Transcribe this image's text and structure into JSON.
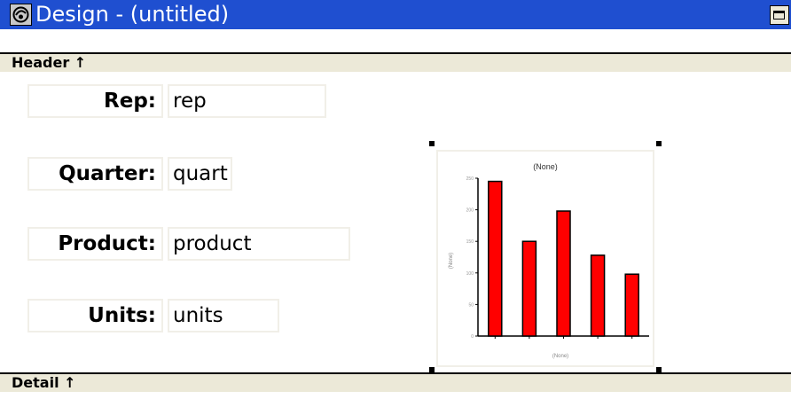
{
  "window": {
    "title": "Design - (untitled)"
  },
  "sections": {
    "header_label": "Header ↑",
    "detail_label": "Detail ↑"
  },
  "fields": [
    {
      "label": "Rep:",
      "value": "rep"
    },
    {
      "label": "Quarter:",
      "value": "quart"
    },
    {
      "label": "Product:",
      "value": "product"
    },
    {
      "label": "Units:",
      "value": "units"
    }
  ],
  "colors": {
    "titlebar": "#1f4fd0",
    "bar_fill": "#ff0000",
    "section_bar": "#ece9d8"
  },
  "icons": {
    "app": "app-icon",
    "maximize": "maximize-icon"
  },
  "chart_data": {
    "type": "bar",
    "title": "(None)",
    "xlabel": "(None)",
    "ylabel": "(None)",
    "ylim": [
      0,
      250
    ],
    "y_ticks": [
      "0",
      "50",
      "100",
      "150",
      "200",
      "250"
    ],
    "categories": [
      "",
      "",
      "",
      "",
      ""
    ],
    "values": [
      245,
      150,
      198,
      128,
      98
    ],
    "grid": false
  }
}
